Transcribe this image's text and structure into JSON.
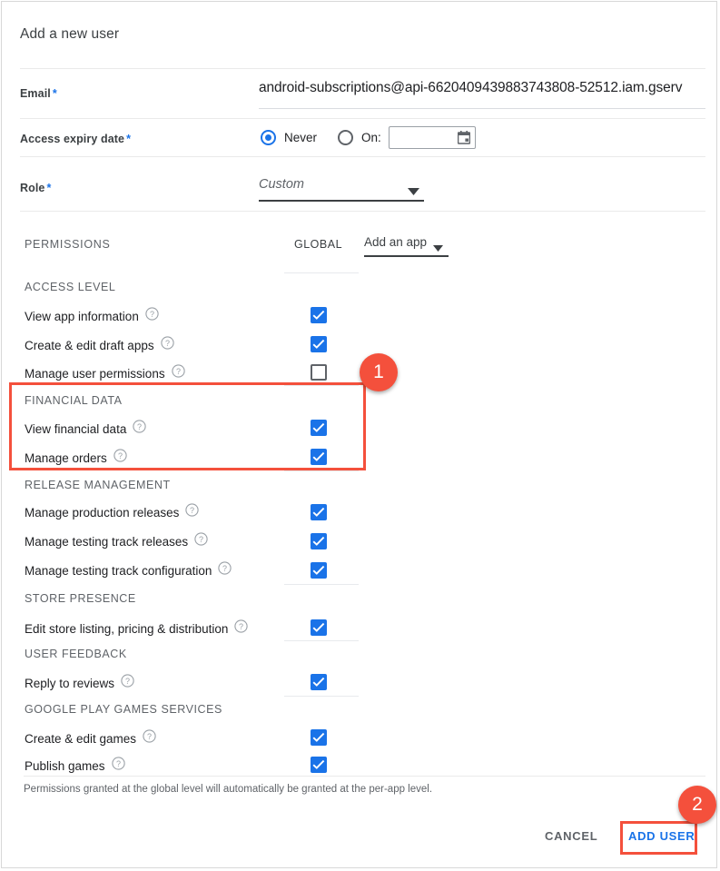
{
  "dialog": {
    "title": "Add a new user",
    "footnote": "Permissions granted at the global level will automatically be granted at the per-app level.",
    "required_marker": "*"
  },
  "fields": {
    "email": {
      "label": "Email",
      "value": "android-subscriptions@api-6620409439883743808-52512.iam.gserv",
      "placeholder": ""
    },
    "access_expiry": {
      "label": "Access expiry date",
      "options": [
        {
          "label": "Never",
          "selected": true
        },
        {
          "label": "On:",
          "selected": false
        }
      ],
      "date_value": "",
      "date_icon": "calendar-icon"
    },
    "role": {
      "label": "Role",
      "value": "Custom",
      "arrow_icon": "chevron-down-icon"
    }
  },
  "permissions": {
    "header": "PERMISSIONS",
    "global_column": "GLOBAL",
    "add_app": {
      "label": "Add an app",
      "arrow_icon": "chevron-down-icon"
    },
    "help_icon": "help-circle-icon",
    "sections": [
      {
        "caption": "ACCESS LEVEL",
        "items": [
          {
            "label": "View app information",
            "checked": true
          },
          {
            "label": "Create & edit draft apps",
            "checked": true
          },
          {
            "label": "Manage user permissions",
            "checked": false
          }
        ]
      },
      {
        "caption": "FINANCIAL DATA",
        "items": [
          {
            "label": "View financial data",
            "checked": true
          },
          {
            "label": "Manage orders",
            "checked": true
          }
        ]
      },
      {
        "caption": "RELEASE MANAGEMENT",
        "items": [
          {
            "label": "Manage production releases",
            "checked": true
          },
          {
            "label": "Manage testing track releases",
            "checked": true
          },
          {
            "label": "Manage testing track configuration",
            "checked": true
          }
        ]
      },
      {
        "caption": "STORE PRESENCE",
        "items": [
          {
            "label": "Edit store listing, pricing & distribution",
            "checked": true
          }
        ]
      },
      {
        "caption": "USER FEEDBACK",
        "items": [
          {
            "label": "Reply to reviews",
            "checked": true
          }
        ]
      },
      {
        "caption": "GOOGLE PLAY GAMES SERVICES",
        "items": [
          {
            "label": "Create & edit games",
            "checked": true
          },
          {
            "label": "Publish games",
            "checked": true
          }
        ]
      }
    ]
  },
  "footer": {
    "cancel_label": "CANCEL",
    "add_user_label": "ADD USER"
  },
  "annotations": {
    "badges": [
      {
        "number": "1",
        "target": "financial-data-section"
      },
      {
        "number": "2",
        "target": "add-user-button"
      }
    ],
    "highlight_color": "#f4503c"
  },
  "colors": {
    "accent_blue": "#1a73e8",
    "text_primary": "#202124",
    "text_secondary": "#5f6368",
    "annotation": "#f4503c"
  }
}
